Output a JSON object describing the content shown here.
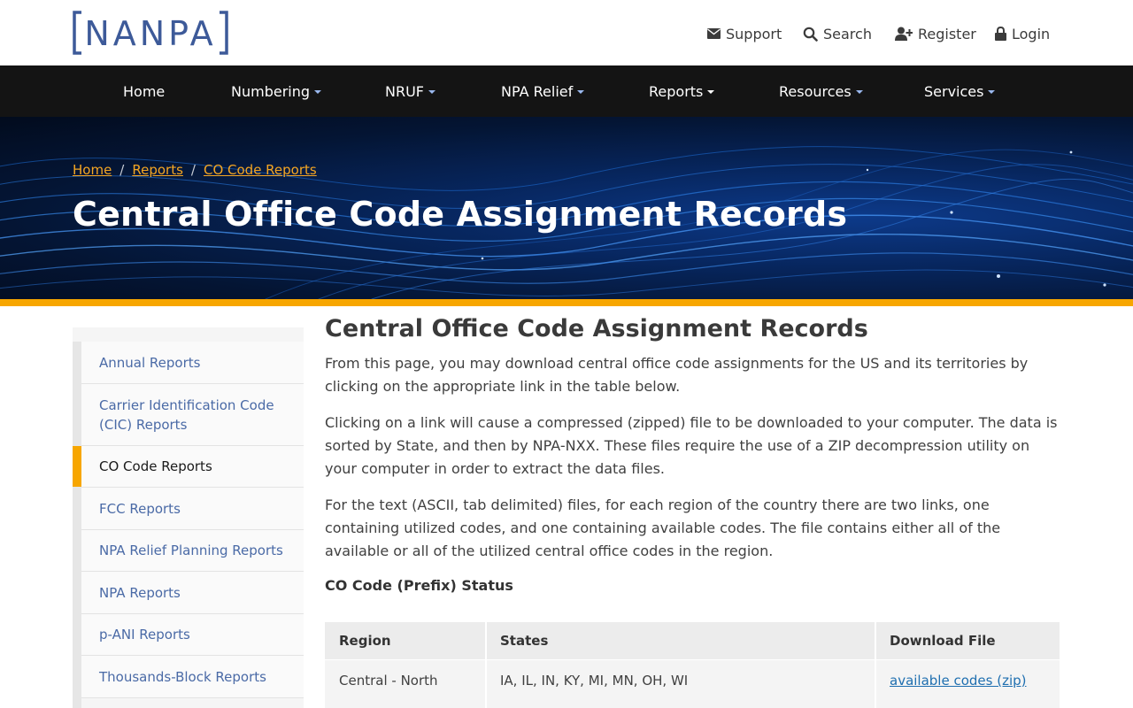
{
  "brand": {
    "logo_text": "NANPA",
    "accent": "#3d5a99",
    "highlight": "#f7a600"
  },
  "utility_nav": [
    {
      "label": "Support",
      "icon": "envelope-icon"
    },
    {
      "label": "Search",
      "icon": "search-icon"
    },
    {
      "label": "Register",
      "icon": "user-plus-icon"
    },
    {
      "label": "Login",
      "icon": "lock-icon"
    }
  ],
  "main_nav": [
    {
      "label": "Home",
      "dropdown": false
    },
    {
      "label": "Numbering",
      "dropdown": true
    },
    {
      "label": "NRUF",
      "dropdown": true
    },
    {
      "label": "NPA Relief",
      "dropdown": true
    },
    {
      "label": "Reports",
      "dropdown": true
    },
    {
      "label": "Resources",
      "dropdown": true
    },
    {
      "label": "Services",
      "dropdown": true
    }
  ],
  "hero": {
    "breadcrumb": [
      "Home",
      "Reports",
      "CO Code Reports"
    ],
    "breadcrumb_separator": "/",
    "title": "Central Office Code Assignment Records"
  },
  "sidebar": {
    "items": [
      {
        "label": "Annual Reports",
        "active": false
      },
      {
        "label": "Carrier Identification Code (CIC) Reports",
        "active": false
      },
      {
        "label": "CO Code Reports",
        "active": true
      },
      {
        "label": "FCC Reports",
        "active": false
      },
      {
        "label": "NPA Relief Planning Reports",
        "active": false
      },
      {
        "label": "NPA Reports",
        "active": false
      },
      {
        "label": "p-ANI Reports",
        "active": false
      },
      {
        "label": "Thousands-Block Reports",
        "active": false
      }
    ]
  },
  "main": {
    "title": "Central Office Code Assignment Records",
    "paragraphs": [
      "From this page, you may download central office code assignments for the US and its territories by clicking on the appropriate link in the table below.",
      "Clicking on a link will cause a compressed (zipped) file to be downloaded to your computer. The data is sorted by State, and then by NPA-NXX. These files require the use of a ZIP decompression utility on your computer in order to extract the data files.",
      "For the text (ASCII, tab delimited) files, for each region of the country there are two links, one containing utilized codes, and one containing available codes. The file contains either all of the available or all of the utilized central office codes in the region."
    ],
    "section_heading": "CO Code (Prefix) Status",
    "table": {
      "headers": [
        "Region",
        "States",
        "Download File"
      ],
      "rows": [
        {
          "region": "Central - North",
          "states": "IA, IL, IN, KY, MI, MN, OH, WI",
          "download": "available codes (zip)"
        }
      ]
    }
  }
}
